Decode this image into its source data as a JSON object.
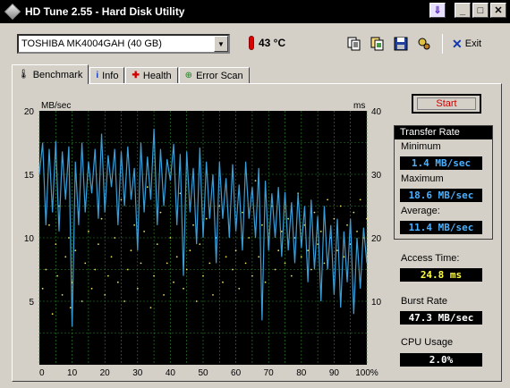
{
  "window": {
    "title": "HD Tune 2.55 - Hard Disk Utility",
    "buttons": {
      "minimize": "_",
      "maximize": "□",
      "close": "✕",
      "special": "⇓"
    }
  },
  "toolbar": {
    "drive": "TOSHIBA MK4004GAH (40 GB)",
    "temperature": "43 °C",
    "exit_label": "Exit",
    "icons": [
      "copy-info-icon",
      "copy-screen-icon",
      "save-icon",
      "options-icon"
    ]
  },
  "tabs": [
    {
      "label": "Benchmark",
      "icon": "benchmark-icon"
    },
    {
      "label": "Info",
      "icon": "info-icon"
    },
    {
      "label": "Health",
      "icon": "health-icon"
    },
    {
      "label": "Error Scan",
      "icon": "error-scan-icon"
    }
  ],
  "side": {
    "start_label": "Start",
    "transfer_rate_title": "Transfer Rate",
    "minimum_label": "Minimum",
    "minimum_value": "1.4 MB/sec",
    "maximum_label": "Maximum",
    "maximum_value": "18.6 MB/sec",
    "average_label": "Average:",
    "average_value": "11.4 MB/sec",
    "access_label": "Access Time:",
    "access_value": "24.8 ms",
    "burst_label": "Burst Rate",
    "burst_value": "47.3 MB/sec",
    "cpu_label": "CPU Usage",
    "cpu_value": "2.0%"
  },
  "colors": {
    "transfer_line": "#3a9fd8",
    "access_dots": "#e8e060",
    "grid": "#2a8a2a",
    "chart_bg": "#000000"
  },
  "chart_data": {
    "type": "line",
    "ylabel": "MB/sec",
    "y2label": "ms",
    "ylim": [
      0,
      20
    ],
    "y2lim": [
      0,
      40
    ],
    "xlim": [
      0,
      100
    ],
    "x_ticks": [
      "0",
      "10",
      "20",
      "30",
      "40",
      "50",
      "60",
      "70",
      "80",
      "90",
      "100%"
    ],
    "y_ticks": [
      "5",
      "10",
      "15",
      "20"
    ],
    "y2_ticks": [
      "10",
      "20",
      "30",
      "40"
    ],
    "grid": true,
    "series": [
      {
        "kind": "transfer_rate_MBps",
        "x": [
          0,
          1,
          2,
          3,
          4,
          5,
          6,
          7,
          8,
          9,
          10,
          11,
          12,
          13,
          14,
          15,
          16,
          17,
          18,
          19,
          20,
          21,
          22,
          23,
          24,
          25,
          26,
          27,
          28,
          29,
          30,
          31,
          32,
          33,
          34,
          35,
          36,
          37,
          38,
          39,
          40,
          41,
          42,
          43,
          44,
          45,
          46,
          47,
          48,
          49,
          50,
          51,
          52,
          53,
          54,
          55,
          56,
          57,
          58,
          59,
          60,
          61,
          62,
          63,
          64,
          65,
          66,
          67,
          68,
          69,
          70,
          71,
          72,
          73,
          74,
          75,
          76,
          77,
          78,
          79,
          80,
          81,
          82,
          83,
          84,
          85,
          86,
          87,
          88,
          89,
          90,
          91,
          92,
          93,
          94,
          95,
          96,
          97,
          98,
          99,
          100
        ],
        "values": [
          15,
          17.5,
          11,
          17,
          12,
          17.6,
          10.5,
          16.8,
          13,
          17.2,
          3,
          16,
          11,
          17.5,
          12,
          16,
          13.5,
          17,
          11.5,
          18.2,
          12,
          16.5,
          14,
          17,
          11,
          16.8,
          12.5,
          17.2,
          13,
          15.5,
          9,
          17.5,
          12,
          16.4,
          13,
          18.6,
          11,
          17,
          12.5,
          16.2,
          14.5,
          17.4,
          11,
          16.6,
          7,
          16.8,
          12,
          15.5,
          9.5,
          17.1,
          10,
          16,
          11.5,
          15,
          8,
          16,
          11.5,
          14.7,
          10,
          15.8,
          10.5,
          14.2,
          9,
          16,
          11.5,
          14,
          10,
          15.5,
          3.5,
          14.5,
          9,
          13.5,
          10,
          14,
          8.5,
          13.6,
          9,
          12.8,
          8,
          13.5,
          9.2,
          12.5,
          6.5,
          13,
          7.5,
          11.7,
          5,
          12.5,
          7.5,
          11,
          5.5,
          11.5,
          4.5,
          10.5,
          6.5,
          11.5,
          4,
          10,
          6,
          10.8,
          8
        ]
      },
      {
        "kind": "access_time_ms",
        "x": [
          1,
          2,
          3,
          4,
          5,
          5.5,
          6,
          7,
          8,
          9,
          9.5,
          10,
          11,
          12,
          13,
          14,
          15,
          16,
          17,
          18,
          19,
          20,
          21,
          22,
          23,
          24,
          25,
          26,
          27,
          28,
          29,
          30,
          31,
          32,
          33,
          34,
          35,
          36,
          37,
          38,
          39,
          40,
          41,
          42,
          43,
          44,
          45,
          46,
          47,
          48,
          49,
          50,
          51,
          52,
          53,
          54,
          55,
          56,
          57,
          58,
          59,
          60,
          61,
          62,
          63,
          64,
          65,
          66,
          67,
          68,
          69,
          70,
          71,
          72,
          73,
          74,
          75,
          76,
          77,
          78,
          79,
          80,
          81,
          82,
          83,
          84,
          85,
          86,
          87,
          88,
          89,
          90,
          91,
          92,
          93,
          94,
          95,
          96,
          97,
          98,
          99,
          100
        ],
        "values": [
          12,
          15,
          22,
          8,
          19,
          14,
          25,
          11,
          17,
          20,
          9,
          13,
          18,
          24,
          10,
          16,
          21,
          12,
          15,
          19,
          23,
          11,
          14,
          17,
          20,
          13,
          26,
          10,
          15,
          18,
          22,
          12,
          16,
          21,
          28,
          9,
          14,
          19,
          24,
          11,
          16,
          20,
          13,
          17,
          27,
          12,
          15,
          18,
          22,
          10,
          19,
          14,
          23,
          16,
          11,
          20,
          25,
          13,
          17,
          21,
          15,
          18,
          12,
          24,
          16,
          20,
          14,
          29,
          17,
          22,
          13,
          19,
          25,
          15,
          18,
          21,
          16,
          23,
          14,
          20,
          27,
          17,
          22,
          18,
          15,
          24,
          19,
          21,
          16,
          26,
          20,
          23,
          18,
          25,
          17,
          22,
          19,
          24,
          21,
          26,
          20,
          23
        ]
      }
    ]
  }
}
